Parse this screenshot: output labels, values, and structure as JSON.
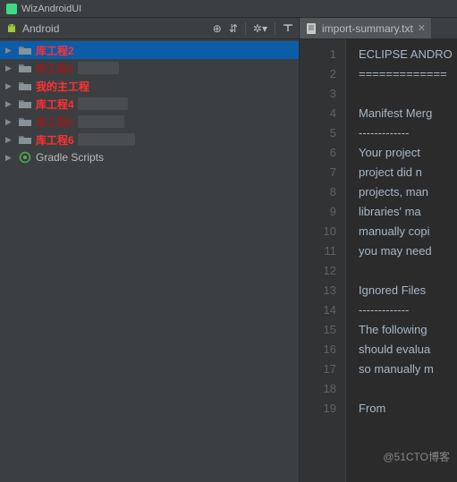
{
  "window": {
    "title": "WizAndroidUI"
  },
  "sidebar": {
    "title": "Android",
    "items": [
      {
        "label": "库工程2",
        "cls": "item-label",
        "folder": true,
        "smudge": 0,
        "selected": true
      },
      {
        "label": "库工程3",
        "cls": "item-label dark",
        "folder": true,
        "smudge": 46
      },
      {
        "label": "我的主工程",
        "cls": "item-label",
        "folder": true,
        "smudge": 0
      },
      {
        "label": "库工程4",
        "cls": "item-label",
        "folder": true,
        "smudge": 56
      },
      {
        "label": "库工程5",
        "cls": "item-label dark",
        "folder": true,
        "smudge": 52
      },
      {
        "label": "库工程6",
        "cls": "item-label",
        "folder": true,
        "smudge": 64
      },
      {
        "label": "Gradle Scripts",
        "cls": "item-label normal",
        "folder": false,
        "smudge": 0
      }
    ]
  },
  "editor": {
    "tab": {
      "label": "import-summary.txt"
    },
    "lines": [
      "ECLIPSE ANDRO",
      "=============",
      "",
      "Manifest Merg",
      "-------------",
      "Your project ",
      "project did n",
      "projects, man",
      "libraries' ma",
      "manually copi",
      "you may need ",
      "",
      "Ignored Files",
      "-------------",
      "The following",
      "should evalua",
      "so manually m",
      "",
      "From"
    ]
  },
  "watermark": "@51CTO博客"
}
